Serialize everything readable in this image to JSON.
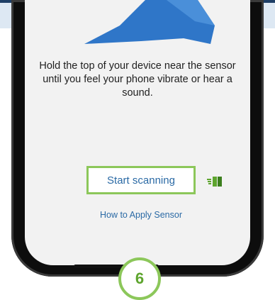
{
  "screen": {
    "instruction": "Hold the top of your device near the sensor until you feel your phone vibrate or hear a sound.",
    "start_button_label": "Start scanning",
    "apply_link_label": "How to Apply Sensor",
    "sensor_icon": "nfc-sensor-icon"
  },
  "badge": {
    "step": "6"
  },
  "colors": {
    "accent_green": "#8cc75a",
    "link_blue": "#2b6aa5",
    "screen_bg": "#f2f2f2",
    "art_blue": "#2f76c8"
  }
}
